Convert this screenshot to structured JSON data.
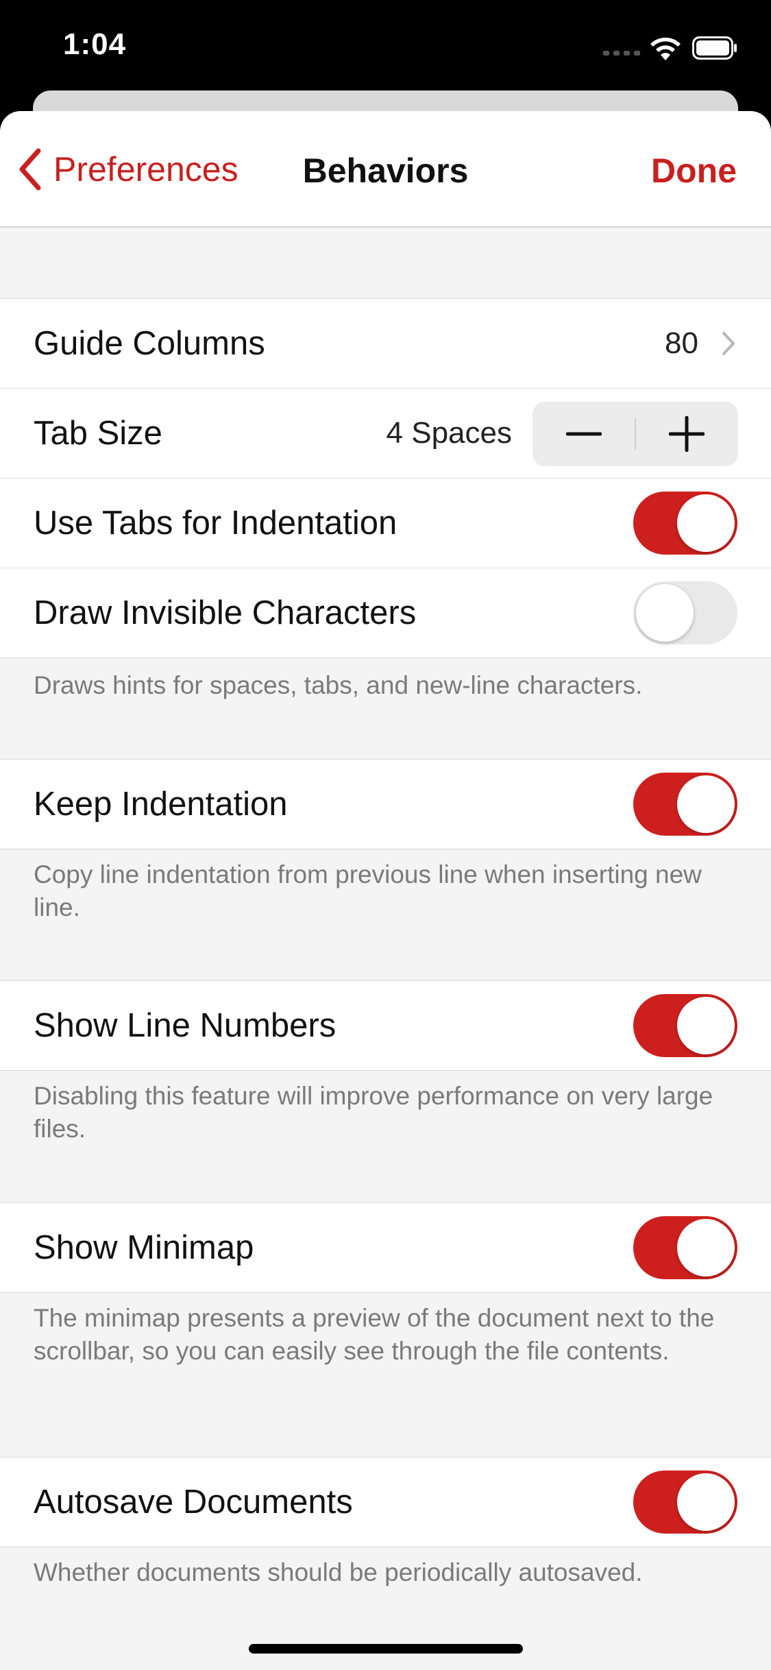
{
  "status_bar": {
    "time": "1:04",
    "icons": [
      "signal-icon",
      "wifi-icon",
      "battery-icon"
    ]
  },
  "navbar": {
    "back_label": "Preferences",
    "title": "Behaviors",
    "done_label": "Done"
  },
  "colors": {
    "accent": "#cd201e",
    "toggle_off": "#e9e9ea",
    "group_background": "#f4f4f4"
  },
  "settings": {
    "guide_columns": {
      "label": "Guide Columns",
      "value": "80"
    },
    "tab_size": {
      "label": "Tab Size",
      "value": "4 Spaces"
    },
    "use_tabs": {
      "label": "Use Tabs for Indentation",
      "on": true
    },
    "draw_invisible": {
      "label": "Draw Invisible Characters",
      "on": false,
      "footer": "Draws hints for spaces, tabs, and new-line characters."
    },
    "keep_indentation": {
      "label": "Keep Indentation",
      "on": true,
      "footer": "Copy line indentation from previous line when inserting new line."
    },
    "show_line_numbers": {
      "label": "Show Line Numbers",
      "on": true,
      "footer": "Disabling this feature will improve performance on very large files."
    },
    "show_minimap": {
      "label": "Show Minimap",
      "on": true,
      "footer": "The minimap presents a preview of the document next to the scrollbar, so you can easily see through the file contents."
    },
    "autosave": {
      "label": "Autosave Documents",
      "on": true,
      "footer": "Whether documents should be periodically autosaved."
    }
  }
}
